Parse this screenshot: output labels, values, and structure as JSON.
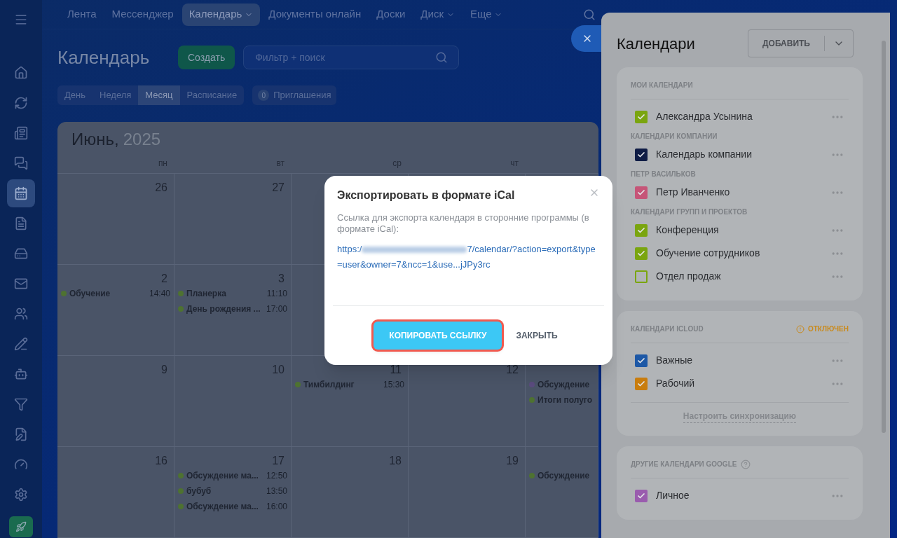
{
  "nav": {
    "items": [
      {
        "label": "Лента",
        "selected": false,
        "dropdown": false
      },
      {
        "label": "Мессенджер",
        "selected": false,
        "dropdown": false
      },
      {
        "label": "Календарь",
        "selected": true,
        "dropdown": true
      },
      {
        "label": "Документы онлайн",
        "selected": false,
        "dropdown": false
      },
      {
        "label": "Доски",
        "selected": false,
        "dropdown": false
      },
      {
        "label": "Диск",
        "selected": false,
        "dropdown": true
      },
      {
        "label": "Еще",
        "selected": false,
        "dropdown": true
      }
    ]
  },
  "sidebar": {
    "items": [
      {
        "selected": false
      },
      {
        "selected": false
      },
      {
        "selected": false
      },
      {
        "selected": false
      },
      {
        "selected": true
      },
      {
        "selected": false
      },
      {
        "selected": false
      },
      {
        "selected": false
      },
      {
        "selected": false
      },
      {
        "selected": false
      },
      {
        "selected": false
      },
      {
        "selected": false
      },
      {
        "selected": false
      },
      {
        "selected": false
      },
      {
        "selected": false
      }
    ]
  },
  "page": {
    "title": "Календарь",
    "create_button": "Создать",
    "search": {
      "placeholder": "Фильтр + поиск"
    },
    "views": [
      {
        "label": "День",
        "selected": false
      },
      {
        "label": "Неделя",
        "selected": false
      },
      {
        "label": "Месяц",
        "selected": true
      },
      {
        "label": "Расписание",
        "selected": false
      }
    ],
    "invitations": {
      "count": "0",
      "label": "Приглашения"
    }
  },
  "calendar": {
    "month": "Июнь,",
    "year": "2025",
    "weekdays": [
      "пн",
      "вт",
      "ср",
      "чт"
    ],
    "weeks": [
      {
        "days": [
          {
            "date": "26"
          },
          {
            "date": "27"
          }
        ]
      },
      {
        "days": [
          {
            "date": "2",
            "events": [
              {
                "name": "Обучение",
                "time": "14:40",
                "color": "#4e7231"
              }
            ]
          },
          {
            "date": "3",
            "events": [
              {
                "name": "Планерка",
                "time": "11:10",
                "color": "#4e7231"
              },
              {
                "name": "День рождения ...",
                "time": "17:00",
                "color": "#4e7231"
              }
            ]
          }
        ]
      },
      {
        "days": [
          {
            "date": "9"
          },
          {
            "date": "10"
          },
          {
            "date": "11",
            "events": [
              {
                "name": "Тимбилдинг",
                "time": "15:30",
                "color": "#4e7231"
              }
            ]
          },
          {
            "date": "12"
          }
        ],
        "column_5": {
          "events": [
            {
              "name": "Обсуждение",
              "color": "#5a4b7e"
            },
            {
              "name": "Итоги полуго",
              "color": "#4e7231"
            }
          ]
        }
      },
      {
        "days": [
          {
            "date": "16"
          },
          {
            "date": "17",
            "events": [
              {
                "name": "Обсуждение ма...",
                "time": "12:50",
                "color": "#4e7231"
              },
              {
                "name": "бубуб",
                "time": "13:50",
                "color": "#4e7231"
              },
              {
                "name": "Обсуждение ма...",
                "time": "16:00",
                "color": "#4e7231"
              }
            ]
          },
          {
            "date": "18"
          },
          {
            "date": "19"
          }
        ],
        "column_5": {
          "events": [
            {
              "name": "Обсуждение",
              "color": "#4e7231"
            }
          ]
        }
      }
    ]
  },
  "modal": {
    "title": "Экспортировать в формате iCal",
    "description": "Ссылка для экспорта календаря в сторонние программы (в формате iCal):",
    "link_start": "https:/",
    "link_end": "7/calendar/?action=export&type=user&owner=7&ncc=1&use...jJPy3rc",
    "buttons": [
      {
        "label": "КОПИРОВАТЬ ССЫЛКУ",
        "kind": "primary",
        "highlighted": true
      },
      {
        "label": "ЗАКРЫТЬ",
        "kind": "link",
        "highlighted": false
      }
    ]
  },
  "panel": {
    "title": "Календари",
    "add_button": "ДОБАВИТЬ",
    "cards": [
      {
        "groups": [
          {
            "heading": "МОИ КАЛЕНДАРИ",
            "items": [
              {
                "name": "Александра Усынина",
                "checked": true,
                "color": "#7aa50f"
              }
            ]
          },
          {
            "heading": "КАЛЕНДАРИ КОМПАНИИ",
            "items": [
              {
                "name": "Календарь компании",
                "checked": true,
                "color": "#0f1c45"
              }
            ]
          },
          {
            "heading": "ПЕТР ВАСИЛЬКОВ",
            "items": [
              {
                "name": "Петр Иванченко",
                "checked": true,
                "color": "#c65578"
              }
            ]
          },
          {
            "heading": "КАЛЕНДАРИ ГРУПП И ПРОЕКТОВ",
            "items": [
              {
                "name": "Конференция",
                "checked": true,
                "color": "#7aa50f"
              },
              {
                "name": "Обучение сотрудников",
                "checked": true,
                "color": "#7aa50f"
              },
              {
                "name": "Отдел продаж",
                "checked": false,
                "color": "#7aa50f"
              }
            ]
          }
        ]
      },
      {
        "groups": [
          {
            "heading": "КАЛЕНДАРИ ICLOUD",
            "status": "ОТКЛЮЧЕН",
            "items": [
              {
                "name": "Важные",
                "checked": true,
                "color": "#1d58a6"
              },
              {
                "name": "Рабочий",
                "checked": true,
                "color": "#c97d0e"
              }
            ]
          }
        ],
        "footer_link": "Настроить синхронизацию"
      },
      {
        "groups": [
          {
            "heading": "ДРУГИЕ КАЛЕНДАРИ GOOGLE",
            "help": true,
            "items": [
              {
                "name": "Личное",
                "checked": true,
                "color": "#9a5cae"
              }
            ]
          }
        ]
      }
    ]
  }
}
